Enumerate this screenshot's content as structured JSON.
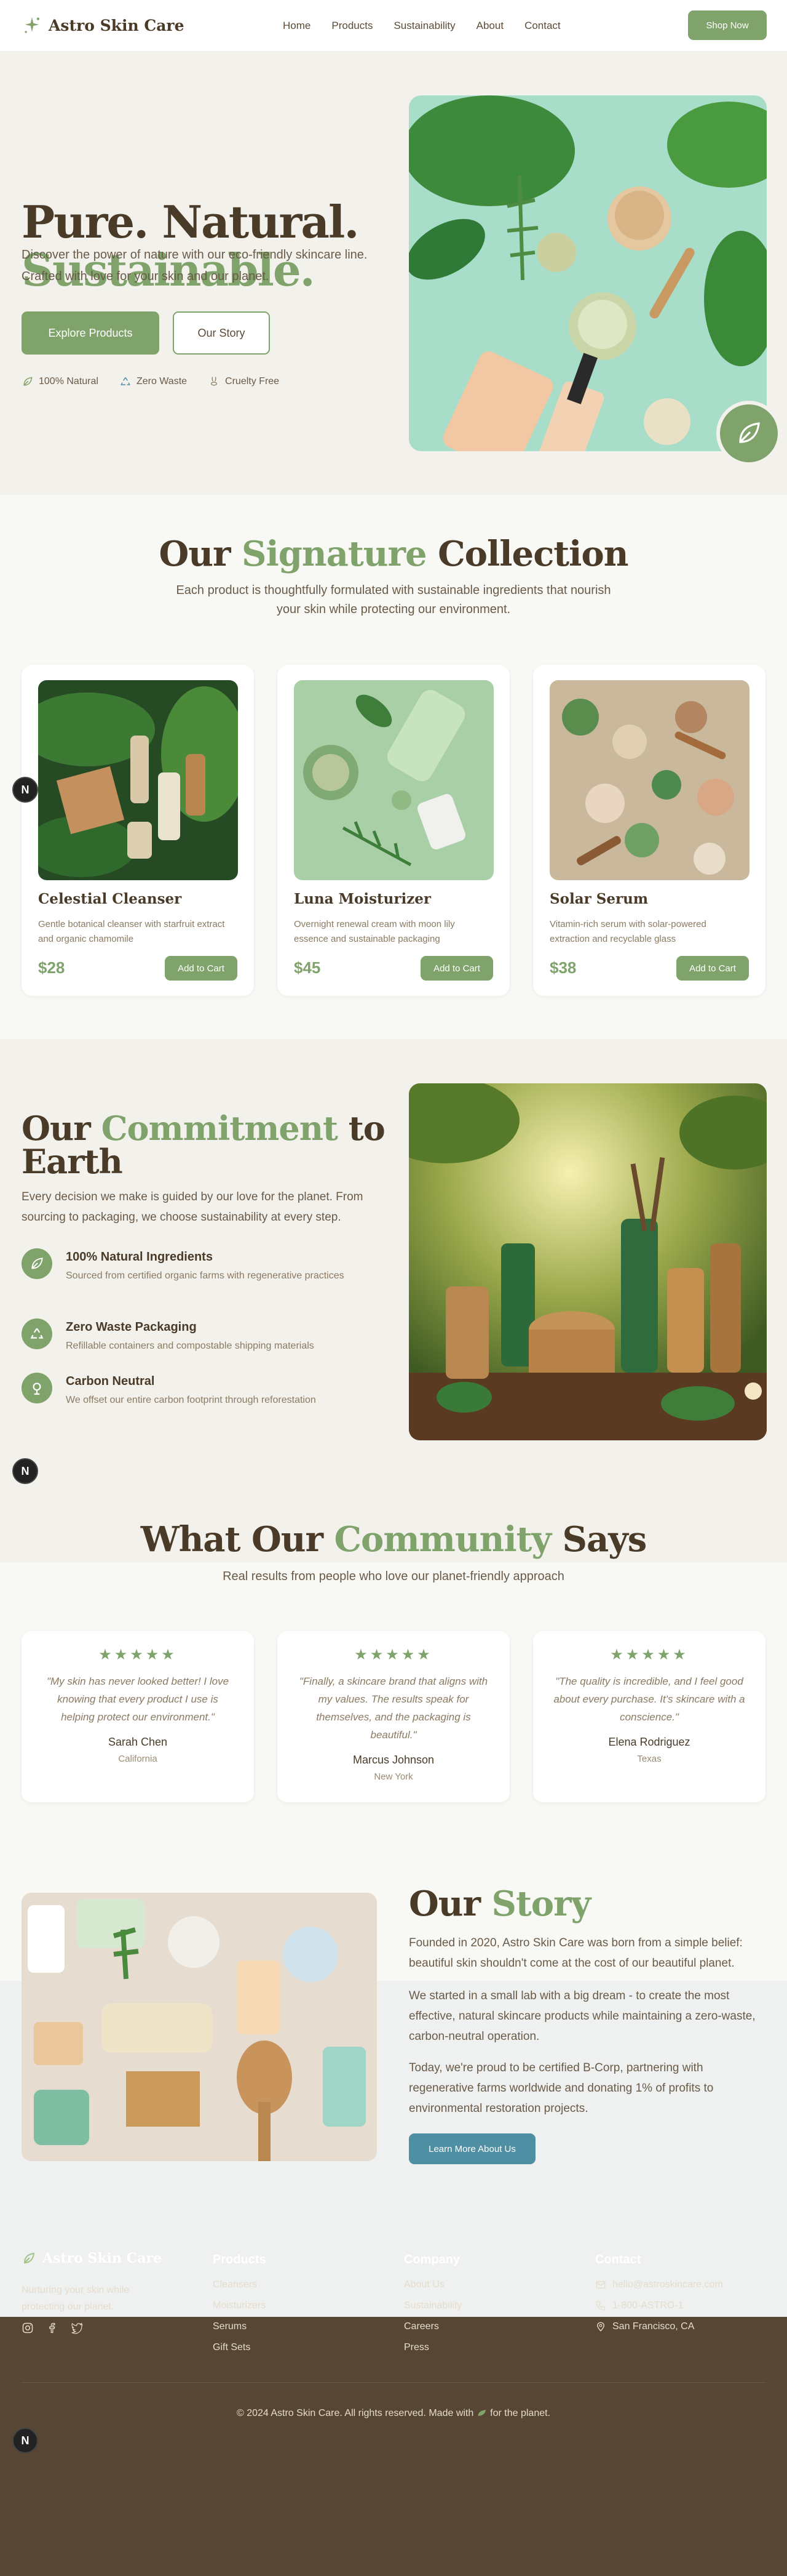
{
  "brand": {
    "name": "Astro Skin Care",
    "accent": "#7fa36a",
    "teal": "#4f8fa3",
    "footer_bg": "#574634"
  },
  "nav": {
    "links": [
      "Home",
      "Products",
      "Sustainability",
      "About",
      "Contact"
    ],
    "cta": "Shop Now"
  },
  "hero": {
    "title_line1": "Pure. Natural.",
    "title_line2": "Sustainable.",
    "lead": "Discover the power of nature with our eco-friendly skincare line. Crafted with love for your skin and our planet.",
    "primary": "Explore Products",
    "secondary": "Our Story",
    "badges": [
      "100% Natural",
      "Zero Waste",
      "Cruelty Free"
    ]
  },
  "collection": {
    "title_a": "Our ",
    "title_b": "Signature",
    "title_c": " Collection",
    "subtitle": "Each product is thoughtfully formulated with sustainable ingredients that nourish your skin while protecting our environment.",
    "products": [
      {
        "name": "Celestial Cleanser",
        "desc": "Gentle botanical cleanser with starfruit extract and organic chamomile",
        "price": "$28",
        "cta": "Add to Cart"
      },
      {
        "name": "Luna Moisturizer",
        "desc": "Overnight renewal cream with moon lily essence and sustainable packaging",
        "price": "$45",
        "cta": "Add to Cart"
      },
      {
        "name": "Solar Serum",
        "desc": "Vitamin-rich serum with solar-powered extraction and recyclable glass",
        "price": "$38",
        "cta": "Add to Cart"
      }
    ]
  },
  "commitment": {
    "title_a": "Our ",
    "title_b": "Commitment",
    "title_c": " to Earth",
    "lead": "Every decision we make is guided by our love for the planet. From sourcing to packaging, we choose sustainability at every step.",
    "features": [
      {
        "title": "100% Natural Ingredients",
        "desc": "Sourced from certified organic farms with regenerative practices",
        "icon": "leaf-icon"
      },
      {
        "title": "Zero Waste Packaging",
        "desc": "Refillable containers and compostable shipping materials",
        "icon": "recycle-icon"
      },
      {
        "title": "Carbon Neutral",
        "desc": "We offset our entire carbon footprint through reforestation",
        "icon": "globe-icon"
      }
    ]
  },
  "testimonials": {
    "title_a": "What Our ",
    "title_b": "Community",
    "title_c": " Says",
    "subtitle": "Real results from people who love our planet-friendly approach",
    "items": [
      {
        "stars": "★★★★★",
        "quote": "\"My skin has never looked better! I love knowing that every product I use is helping protect our environment.\"",
        "name": "Sarah Chen",
        "location": "California"
      },
      {
        "stars": "★★★★★",
        "quote": "\"Finally, a skincare brand that aligns with my values. The results speak for themselves, and the packaging is beautiful.\"",
        "name": "Marcus Johnson",
        "location": "New York"
      },
      {
        "stars": "★★★★★",
        "quote": "\"The quality is incredible, and I feel good about every purchase. It's skincare with a conscience.\"",
        "name": "Elena Rodriguez",
        "location": "Texas"
      }
    ]
  },
  "story": {
    "title_a": "Our ",
    "title_b": "Story",
    "p1": "Founded in 2020, Astro Skin Care was born from a simple belief: beautiful skin shouldn't come at the cost of our beautiful planet.",
    "p2": "We started in a small lab with a big dream - to create the most effective, natural skincare products while maintaining a zero-waste, carbon-neutral operation.",
    "p3": "Today, we're proud to be certified B-Corp, partnering with regenerative farms worldwide and donating 1% of profits to environmental restoration projects.",
    "cta": "Learn More About Us"
  },
  "footer": {
    "tagline": "Nurturing your skin while protecting our planet.",
    "products_title": "Products",
    "products": [
      "Cleansers",
      "Moisturizers",
      "Serums",
      "Gift Sets"
    ],
    "company_title": "Company",
    "company": [
      "About Us",
      "Sustainability",
      "Careers",
      "Press"
    ],
    "contact_title": "Contact",
    "email": "hello@astroskincare.com",
    "phone": "1-800-ASTRO-1",
    "address": "San Francisco, CA",
    "copyright_a": "© 2024 Astro Skin Care. All rights reserved. Made with",
    "copyright_b": "for the planet."
  },
  "badge_letter": "N"
}
